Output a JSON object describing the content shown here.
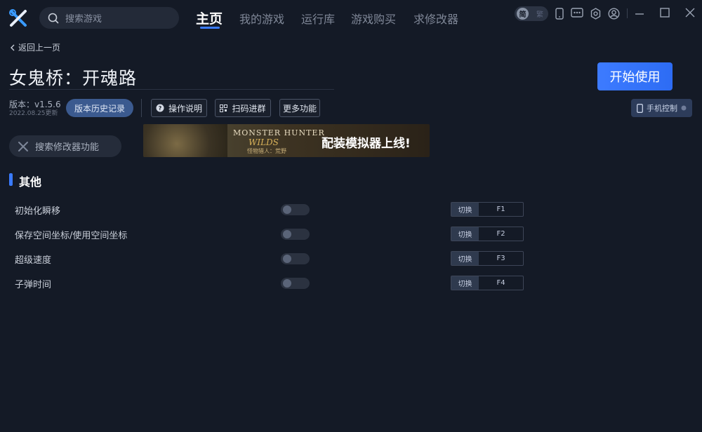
{
  "topbar": {
    "search_placeholder": "搜索游戏",
    "tabs": [
      {
        "label": "主页",
        "active": true
      },
      {
        "label": "我的游戏"
      },
      {
        "label": "运行库"
      },
      {
        "label": "游戏购买"
      },
      {
        "label": "求修改器"
      }
    ],
    "mode_toggle": {
      "on_label": "简",
      "off_label": "繁"
    },
    "icons": [
      "phone-icon",
      "chat-icon",
      "settings-icon",
      "user-icon",
      "minimize-icon",
      "maximize-icon",
      "close-icon"
    ],
    "accent_color": "#3a7bff"
  },
  "back_label": "返回上一页",
  "game": {
    "title": "女鬼桥：开魂路",
    "start_label": "开始使用",
    "version": "版本：v1.5.6",
    "update_date": "2022.08.25更新",
    "history_label": "版本历史记录",
    "help_label": "操作说明",
    "scan_label": "扫码进群",
    "more_label": "更多功能",
    "phone_label": "手机控制"
  },
  "mod_search_placeholder": "搜索修改器功能",
  "banner": {
    "brand": "MONSTER HUNTER",
    "subtitle": "WILDS",
    "sub_cn": "怪物猎人：荒野",
    "slogan": "配装模拟器上线!"
  },
  "section_title": "其他",
  "mods": [
    {
      "name": "初始化瞬移",
      "hotkey_label": "切换",
      "key": "F1",
      "enabled": false
    },
    {
      "name": "保存空间坐标/使用空间坐标",
      "hotkey_label": "切换",
      "key": "F2",
      "enabled": false
    },
    {
      "name": "超级速度",
      "hotkey_label": "切换",
      "key": "F3",
      "enabled": false
    },
    {
      "name": "子弹时间",
      "hotkey_label": "切换",
      "key": "F4",
      "enabled": false
    }
  ]
}
